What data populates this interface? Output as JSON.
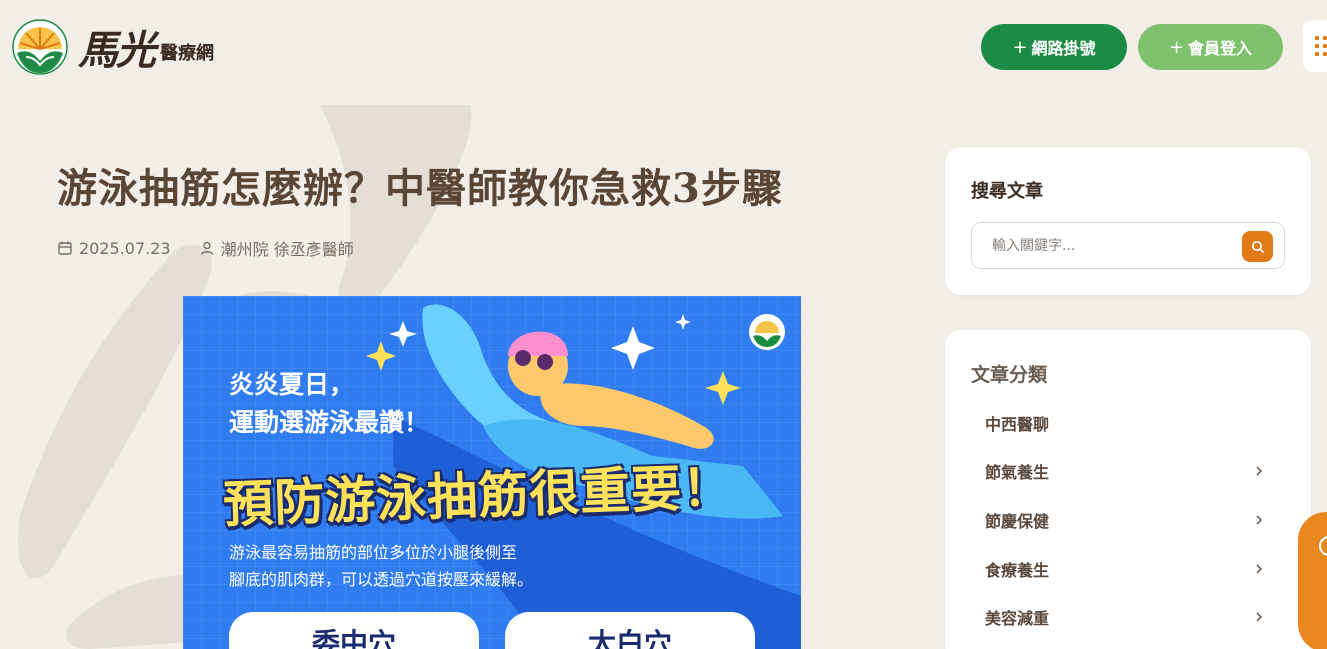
{
  "header": {
    "brand": "馬光",
    "brand_sub": "醫療網",
    "register_label": "網路掛號",
    "login_label": "會員登入",
    "plus": "+",
    "menu_icon": "grid-dots-icon"
  },
  "article": {
    "title": "游泳抽筋怎麼辦？中醫師教你急救3步驟",
    "date": "2025.07.23",
    "author": "潮州院 徐丞彥醫師"
  },
  "hero": {
    "line1": "炎炎夏日，",
    "line2": "運動選游泳最讚！",
    "headline": "預防游泳抽筋很重要！",
    "desc1": "游泳最容易抽筋的部位多位於小腿後側至",
    "desc2": "腳底的肌肉群，可以透過穴道按壓來緩解。",
    "card_a": "委中穴",
    "card_b": "太白穴"
  },
  "sidebar": {
    "search_title": "搜尋文章",
    "search_placeholder": "輸入關鍵字...",
    "categories_title": "文章分類",
    "categories": [
      {
        "label": "中西醫聊",
        "has_children": false
      },
      {
        "label": "節氣養生",
        "has_children": true
      },
      {
        "label": "節慶保健",
        "has_children": true
      },
      {
        "label": "食療養生",
        "has_children": true
      },
      {
        "label": "美容減重",
        "has_children": true
      }
    ]
  },
  "colors": {
    "register_green": "#1c8c44",
    "login_green": "#7fc26d",
    "accent_orange": "#e07b17",
    "background": "#f3efe8",
    "hero_blue": "#2f7cf0"
  }
}
